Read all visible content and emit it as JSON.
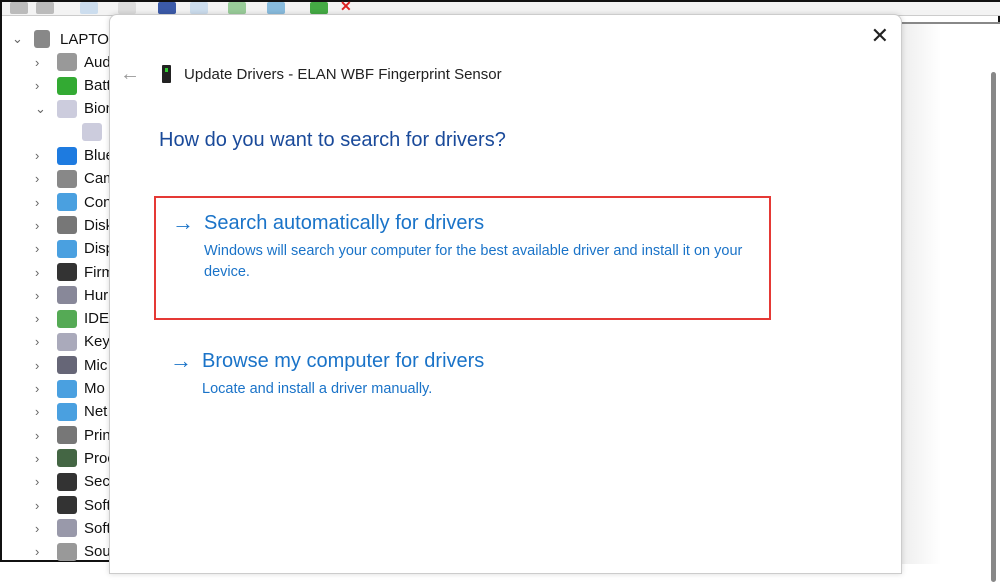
{
  "tree": {
    "root": "LAPTOP",
    "items": [
      "Aud",
      "Batt",
      "Bion",
      "",
      "Blue",
      "Cam",
      "Con",
      "Disk",
      "Disp",
      "Firm",
      "Hur",
      "IDE",
      "Key",
      "Mic",
      "Mo",
      "Net",
      "Prin",
      "Proc",
      "Secu",
      "Soft",
      "Soft",
      "Sou"
    ]
  },
  "dialog": {
    "title": "Update Drivers - ELAN WBF Fingerprint Sensor",
    "question": "How do you want to search for drivers?",
    "options": [
      {
        "title": "Search automatically for drivers",
        "desc": "Windows will search your computer for the best available driver and install it on your device."
      },
      {
        "title": "Browse my computer for drivers",
        "desc": "Locate and install a driver manually."
      }
    ],
    "close": "✕",
    "back": "←",
    "arrow": "→"
  },
  "colors": {
    "accent": "#1a73c8",
    "highlight": "#e53935"
  }
}
